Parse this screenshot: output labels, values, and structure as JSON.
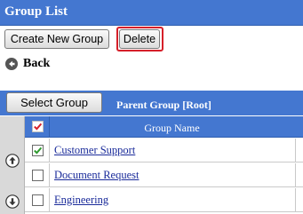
{
  "header": {
    "title": "Group List"
  },
  "toolbar": {
    "create_label": "Create New Group",
    "delete_label": "Delete"
  },
  "nav": {
    "back_label": "Back"
  },
  "group_bar": {
    "select_label": "Select Group",
    "parent_group": "Parent Group [Root]"
  },
  "table": {
    "header": {
      "name_column": "Group Name",
      "select_all_checked": true
    },
    "rows": [
      {
        "name": "Customer Support",
        "checked": true
      },
      {
        "name": "Document Request",
        "checked": false
      },
      {
        "name": "Engineering",
        "checked": false
      }
    ]
  },
  "colors": {
    "accent": "#4477d0",
    "highlight": "#d6202a",
    "link": "#1a2b9a",
    "check": "#2e9a2e"
  },
  "icons": [
    "back-circle-arrow-icon",
    "move-up-icon",
    "move-down-icon",
    "checkbox-icon"
  ]
}
